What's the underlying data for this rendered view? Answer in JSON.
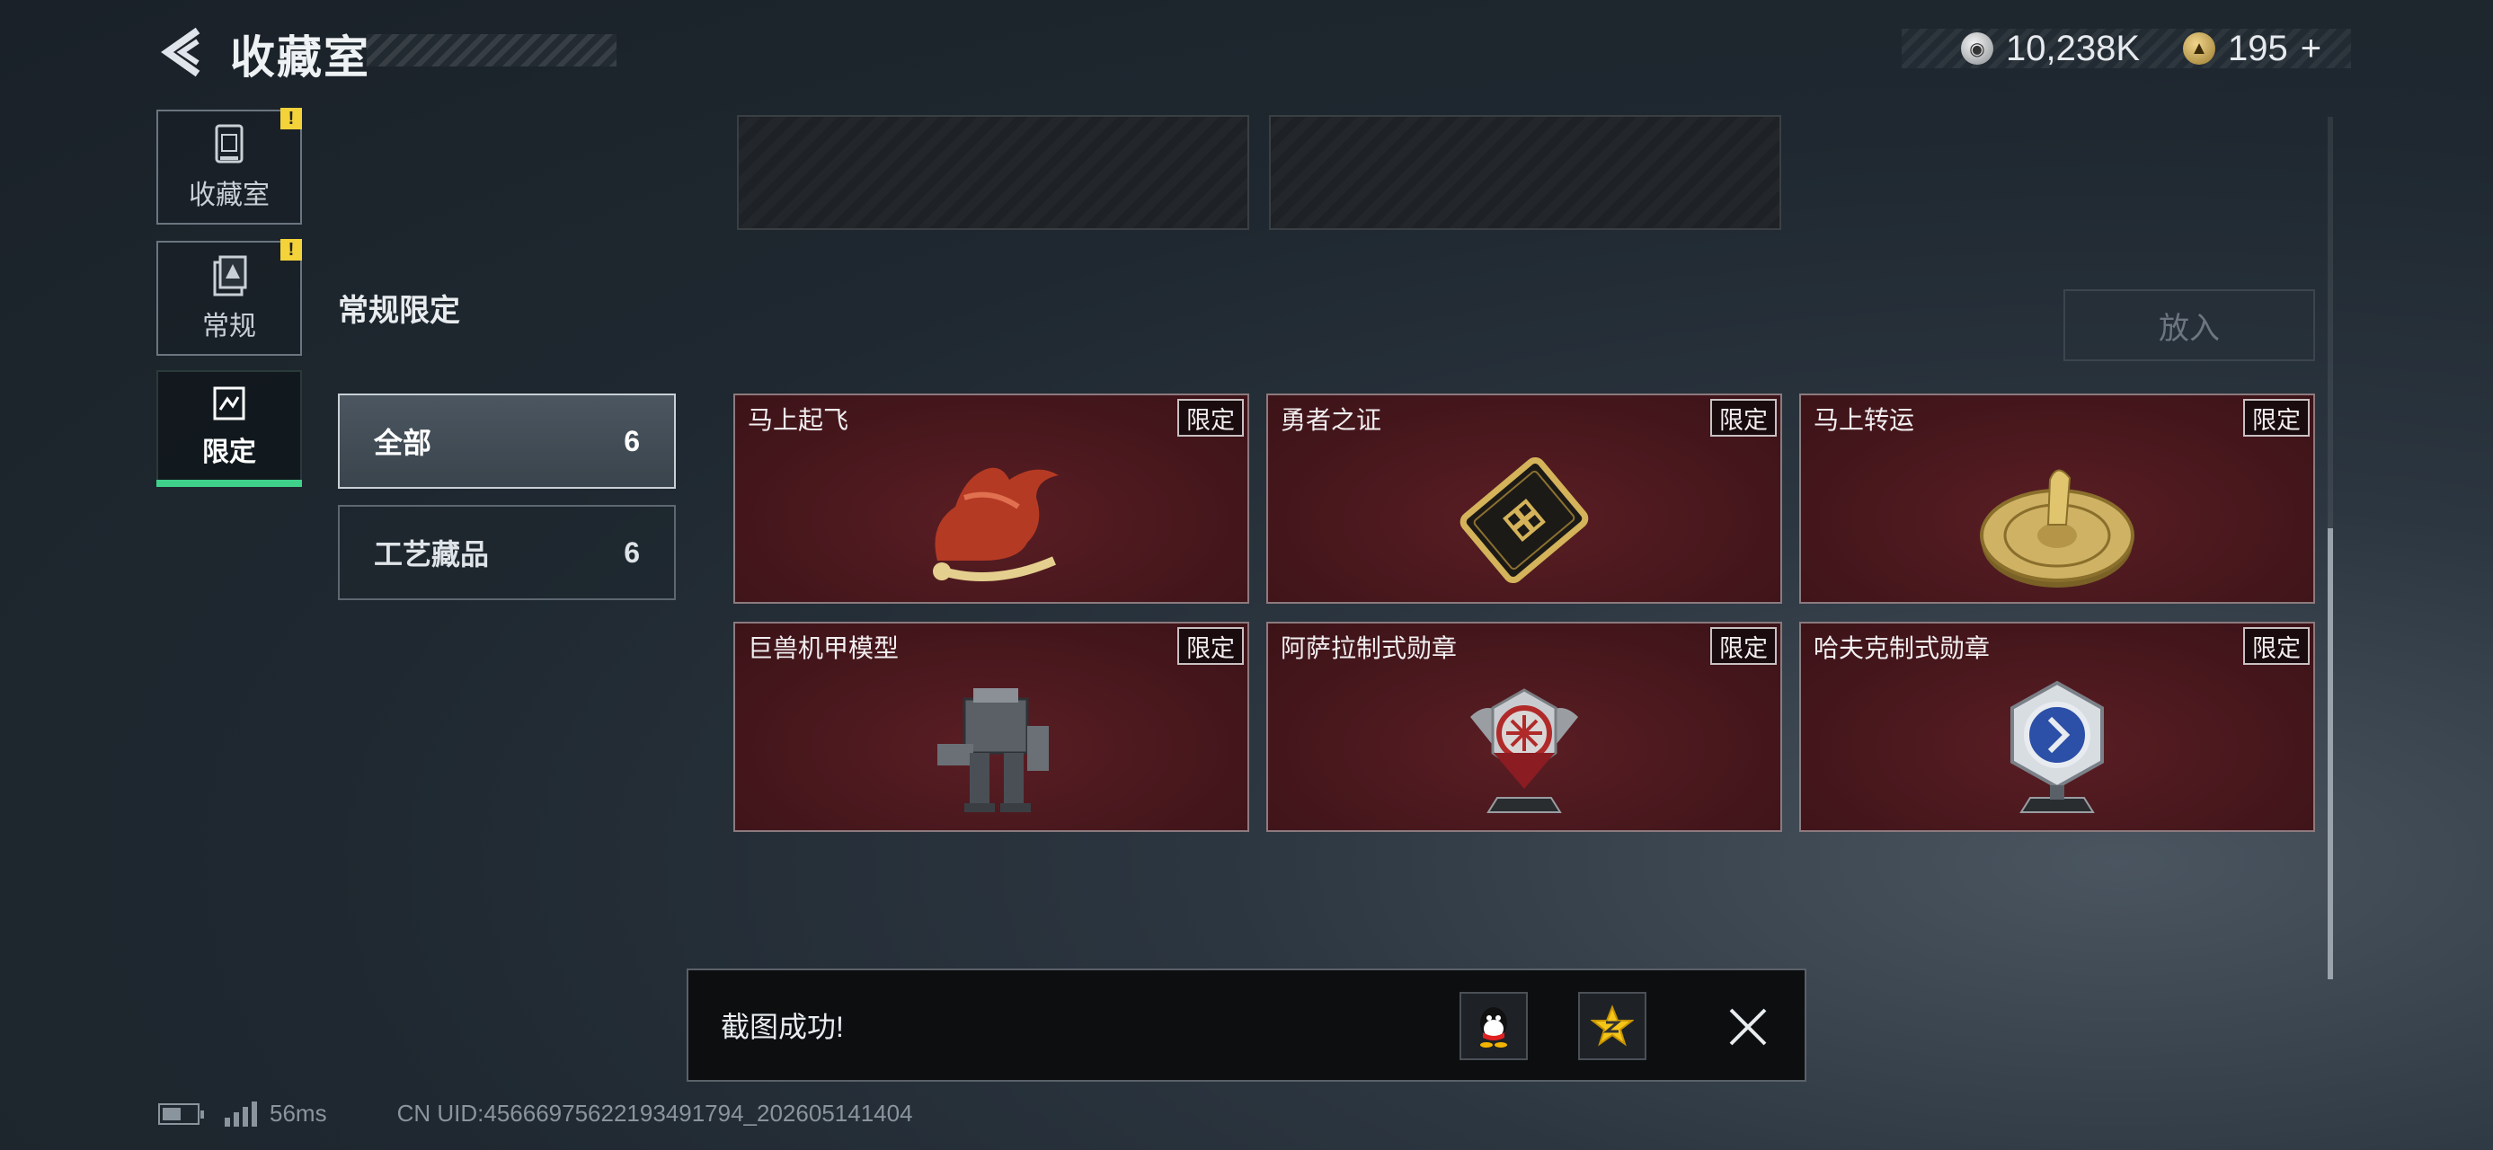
{
  "header": {
    "title": "收藏室",
    "currency": [
      {
        "icon": "silver-coin-icon",
        "value": "10,238K"
      },
      {
        "icon": "gold-coin-icon",
        "value": "195",
        "add": "+"
      }
    ]
  },
  "sidenav": {
    "items": [
      {
        "label": "收藏室",
        "icon": "collection-room-icon",
        "alert": "!"
      },
      {
        "label": "常规",
        "icon": "regular-icon",
        "alert": "!"
      },
      {
        "label": "限定",
        "icon": "limited-icon",
        "active": true
      }
    ]
  },
  "section": {
    "title": "常规限定",
    "put_button": "放入"
  },
  "filters": [
    {
      "label": "全部",
      "count": "6",
      "active": true
    },
    {
      "label": "工艺藏品",
      "count": "6"
    }
  ],
  "cards": [
    {
      "name": "马上起飞",
      "tag": "限定",
      "art": "red-horse-figurine"
    },
    {
      "name": "勇者之证",
      "tag": "限定",
      "art": "gold-card-badge"
    },
    {
      "name": "马上转运",
      "tag": "限定",
      "art": "gold-compass-horse"
    },
    {
      "name": "巨兽机甲模型",
      "tag": "限定",
      "art": "mech-model"
    },
    {
      "name": "阿萨拉制式勋章",
      "tag": "限定",
      "art": "red-medal"
    },
    {
      "name": "哈夫克制式勋章",
      "tag": "限定",
      "art": "blue-medal"
    }
  ],
  "toast": {
    "message": "截图成功!",
    "share_targets": [
      "qq-icon",
      "qzone-icon"
    ]
  },
  "footer": {
    "ping": "56ms",
    "uid": "CN UID:4566697562219349179​4_202605141404"
  },
  "colors": {
    "accent_green": "#3fd08a",
    "card_bg": "#46171c",
    "warn_yellow": "#f3d23a"
  }
}
